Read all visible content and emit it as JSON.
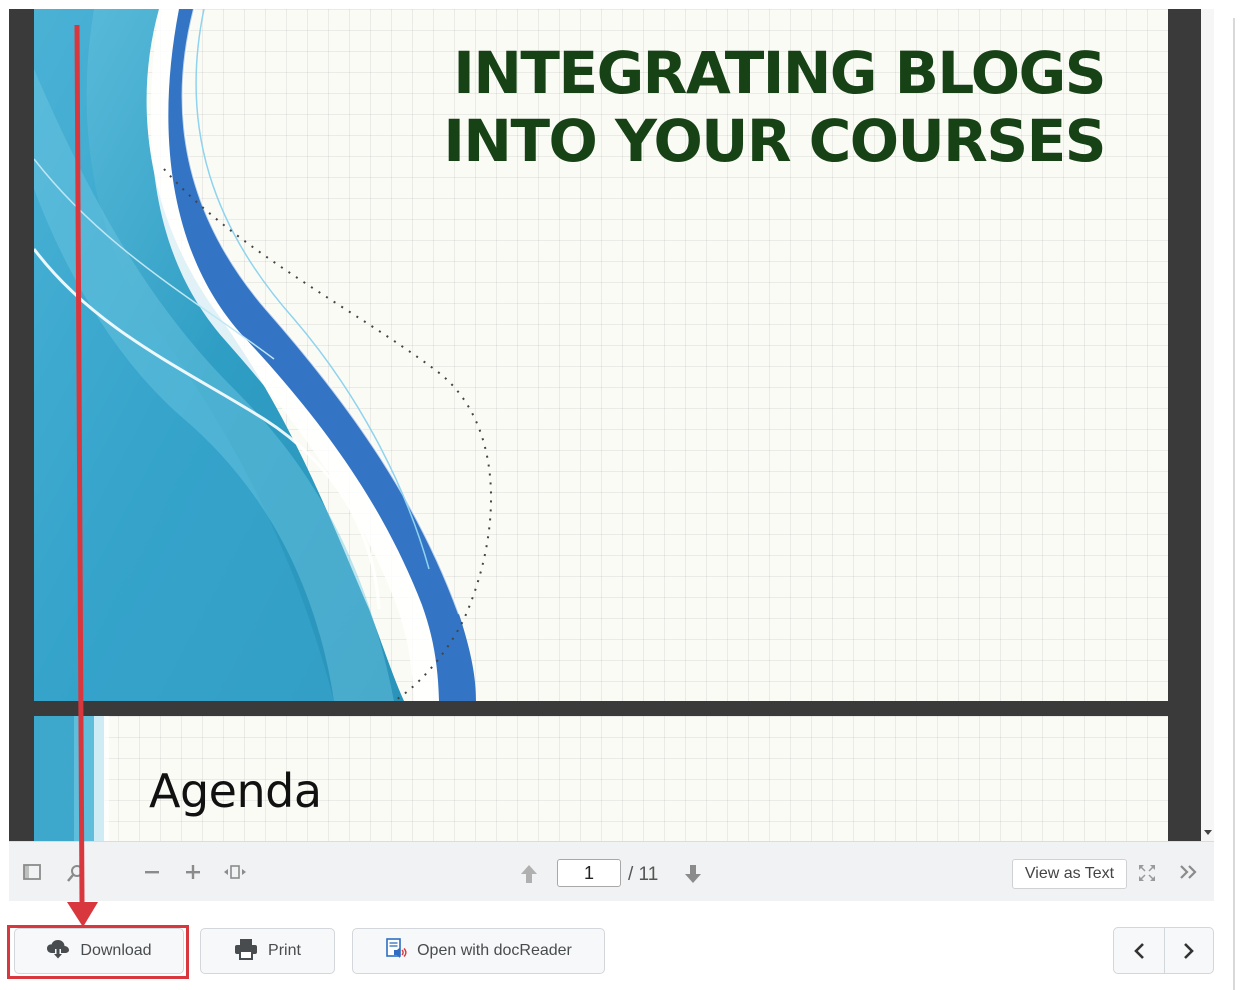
{
  "slides": {
    "page1": {
      "title_line1": "INTEGRATING BLOGS",
      "title_line2": "INTO YOUR COURSES"
    },
    "page2": {
      "title": "Agenda"
    }
  },
  "toolbar": {
    "current_page": "1",
    "total_pages": "/ 11",
    "view_as_text_label": "View as Text",
    "icons": [
      "sidebar-toggle-icon",
      "search-icon",
      "zoom-out-icon",
      "zoom-in-icon",
      "fit-width-icon",
      "previous-page-icon",
      "next-page-icon",
      "fullscreen-icon",
      "more-icon"
    ]
  },
  "actions": {
    "download_label": "Download",
    "print_label": "Print",
    "docreader_label": "Open with docReader"
  },
  "colors": {
    "slide_title": "#174216",
    "highlight": "#d9373e",
    "wave_blue": "#3474c4",
    "wave_teal": "#3aa3c9"
  }
}
